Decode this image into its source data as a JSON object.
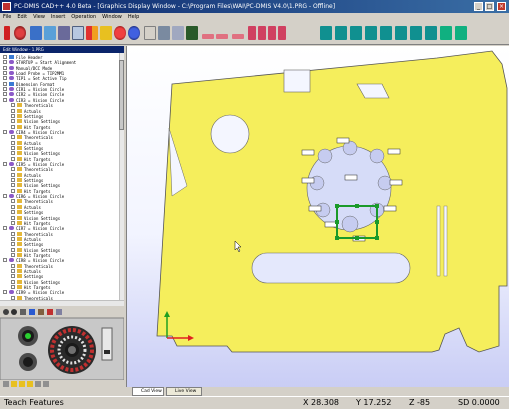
{
  "window": {
    "title": "PC-DMIS CAD++ 4.0 Beta - [Graphics Display Window - C:\\Program Files\\WAI\\PC-DMIS V4.0\\1.PRG - Offline]"
  },
  "menu": [
    "File",
    "Edit",
    "View",
    "Insert",
    "Operation",
    "Window",
    "Help"
  ],
  "tree_header": "Edit Window - 1.PRG",
  "tree_rows": [
    {
      "level": 0,
      "icon": "doc",
      "label": "File Header"
    },
    {
      "level": 0,
      "icon": "feat",
      "label": "STARTUP = Start Alignment"
    },
    {
      "level": 0,
      "icon": "feat",
      "label": "Manual/DCC Mode"
    },
    {
      "level": 0,
      "icon": "feat",
      "label": "Load Probe = TIP2MM1"
    },
    {
      "level": 0,
      "icon": "feat",
      "label": "TIP1 = Set Active Tip"
    },
    {
      "level": 0,
      "icon": "doc",
      "label": "Dimension Format"
    },
    {
      "level": 0,
      "icon": "feat",
      "label": "CIR1 = Vision Circle"
    },
    {
      "level": 0,
      "icon": "feat",
      "label": "CIR2 = Vision Circle"
    },
    {
      "level": 0,
      "icon": "feat",
      "label": "CIR3 = Vision Circle"
    },
    {
      "level": 1,
      "icon": "fold",
      "label": "Theoreticals"
    },
    {
      "level": 1,
      "icon": "fold",
      "label": "Actuals"
    },
    {
      "level": 1,
      "icon": "fold",
      "label": "Settings"
    },
    {
      "level": 1,
      "icon": "fold",
      "label": "Vision Settings"
    },
    {
      "level": 1,
      "icon": "fold",
      "label": "Hit Targets"
    },
    {
      "level": 0,
      "icon": "feat",
      "label": "CIR4 = Vision Circle"
    },
    {
      "level": 1,
      "icon": "fold",
      "label": "Theoreticals"
    },
    {
      "level": 1,
      "icon": "fold",
      "label": "Actuals"
    },
    {
      "level": 1,
      "icon": "fold",
      "label": "Settings"
    },
    {
      "level": 1,
      "icon": "fold",
      "label": "Vision Settings"
    },
    {
      "level": 1,
      "icon": "fold",
      "label": "Hit Targets"
    },
    {
      "level": 0,
      "icon": "feat",
      "label": "CIR5 = Vision Circle"
    },
    {
      "level": 1,
      "icon": "fold",
      "label": "Theoreticals"
    },
    {
      "level": 1,
      "icon": "fold",
      "label": "Actuals"
    },
    {
      "level": 1,
      "icon": "fold",
      "label": "Settings"
    },
    {
      "level": 1,
      "icon": "fold",
      "label": "Vision Settings"
    },
    {
      "level": 1,
      "icon": "fold",
      "label": "Hit Targets"
    },
    {
      "level": 0,
      "icon": "feat",
      "label": "CIR6 = Vision Circle"
    },
    {
      "level": 1,
      "icon": "fold",
      "label": "Theoreticals"
    },
    {
      "level": 1,
      "icon": "fold",
      "label": "Actuals"
    },
    {
      "level": 1,
      "icon": "fold",
      "label": "Settings"
    },
    {
      "level": 1,
      "icon": "fold",
      "label": "Vision Settings"
    },
    {
      "level": 1,
      "icon": "fold",
      "label": "Hit Targets"
    },
    {
      "level": 0,
      "icon": "feat",
      "label": "CIR7 = Vision Circle"
    },
    {
      "level": 1,
      "icon": "fold",
      "label": "Theoreticals"
    },
    {
      "level": 1,
      "icon": "fold",
      "label": "Actuals"
    },
    {
      "level": 1,
      "icon": "fold",
      "label": "Settings"
    },
    {
      "level": 1,
      "icon": "fold",
      "label": "Vision Settings"
    },
    {
      "level": 1,
      "icon": "fold",
      "label": "Hit Targets"
    },
    {
      "level": 0,
      "icon": "feat",
      "label": "CIR8 = Vision Circle"
    },
    {
      "level": 1,
      "icon": "fold",
      "label": "Theoreticals"
    },
    {
      "level": 1,
      "icon": "fold",
      "label": "Actuals"
    },
    {
      "level": 1,
      "icon": "fold",
      "label": "Settings"
    },
    {
      "level": 1,
      "icon": "fold",
      "label": "Vision Settings"
    },
    {
      "level": 1,
      "icon": "fold",
      "label": "Hit Targets"
    },
    {
      "level": 0,
      "icon": "feat",
      "label": "CIR9 = Vision Circle"
    },
    {
      "level": 1,
      "icon": "fold",
      "label": "Theoreticals"
    }
  ],
  "viewport": {
    "part_color": "#f5ee5c",
    "background_top": "#ffffff",
    "background_bottom": "#c9cdf5",
    "selection_color": "#1a9a2a",
    "axis_x_color": "#e02020",
    "axis_y_color": "#20a020"
  },
  "tabs": {
    "cad_view": "Cad View",
    "live_view": "Live View"
  },
  "status": {
    "mode": "Teach Features",
    "x": "X 28.308",
    "y": "Y 17.252",
    "z": "Z -85",
    "sd": "SD 0.0000"
  }
}
